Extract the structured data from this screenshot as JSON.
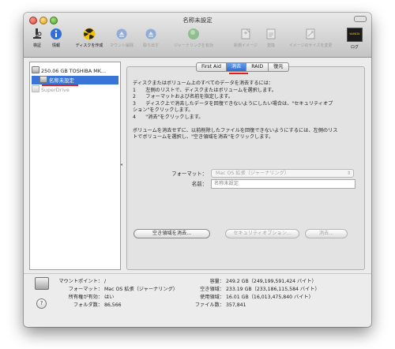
{
  "window": {
    "title": "名称未設定"
  },
  "toolbar": {
    "items": [
      {
        "id": "verify",
        "label": "検証",
        "icon": "microscope-icon",
        "enabled": true
      },
      {
        "id": "info",
        "label": "情報",
        "icon": "info-icon",
        "enabled": true
      },
      {
        "id": "burn",
        "label": "ディスクを作成",
        "icon": "radiation-burn-icon",
        "enabled": true
      },
      {
        "id": "mount",
        "label": "マウント解除",
        "icon": "unmount-icon",
        "enabled": false
      },
      {
        "id": "eject",
        "label": "取り出す",
        "icon": "eject-icon",
        "enabled": false
      },
      {
        "id": "journal",
        "label": "ジャーナリングを有効",
        "icon": "journal-icon",
        "enabled": false
      },
      {
        "id": "newimage",
        "label": "新規イメージ",
        "icon": "new-image-icon",
        "enabled": false
      },
      {
        "id": "convert",
        "label": "変換",
        "icon": "convert-icon",
        "enabled": false
      },
      {
        "id": "resize",
        "label": "イメージのサイズを変更",
        "icon": "resize-image-icon",
        "enabled": false
      },
      {
        "id": "log",
        "label": "ログ",
        "icon": "console-log-icon",
        "enabled": true
      }
    ],
    "log_icon_text": "WARNIN"
  },
  "sidebar": {
    "disk": "250.06 GB TOSHIBA MK...",
    "volume": "名称未設定",
    "superdrive": "SuperDrive"
  },
  "tabs": [
    "First Aid",
    "消去",
    "RAID",
    "復元"
  ],
  "active_tab": "消去",
  "erase": {
    "intro": "ディスクまたはボリューム上のすべてのデータを消去するには：",
    "step1": "1　　左側のリストで、ディスクまたはボリュームを選択します。",
    "step2": "2　　フォーマットおよび名前を指定します。",
    "step3a": "3　　ディスク上で消去したデータを回復できないようにしたい場合は、\"セキュリティオプ",
    "step3b": "ション\"をクリックします。",
    "step4": "4　　\"消去\"をクリックします。",
    "note1": "ボリュームを消去せずに、以前削除したファイルを回復できないようにするには、左側のリス",
    "note2": "トでボリュームを選択し、\"空き領域を消去\"をクリックします。",
    "format_label": "フォーマット：",
    "format_value": "Mac OS 拡張（ジャーナリング）",
    "name_label": "名前：",
    "name_value": "名称未設定",
    "erase_free_button": "空き領域を消去...",
    "security_button": "セキュリティオプション...",
    "erase_button": "消去..."
  },
  "info": {
    "mount_point_label": "マウントポイント：",
    "mount_point_value": "/",
    "format_label": "フォーマット：",
    "format_value": "Mac OS 拡張（ジャーナリング）",
    "owners_label": "所有権が有効：",
    "owners_value": "はい",
    "folders_label": "フォルダ数：",
    "folders_value": "86,566",
    "capacity_label": "容量：",
    "capacity_value": "249.2 GB（249,199,591,424 バイト）",
    "available_label": "空き領域：",
    "available_value": "233.19 GB（233,186,115,584 バイト）",
    "used_label": "使用領域：",
    "used_value": "16.01 GB（16,013,475,840 バイト）",
    "files_label": "ファイル数：",
    "files_value": "357,841"
  },
  "help": {
    "symbol": "?"
  },
  "colors": {
    "selection": "#3875d7",
    "annotation": "#e0201a",
    "active_tab": "#3d7ad8"
  }
}
